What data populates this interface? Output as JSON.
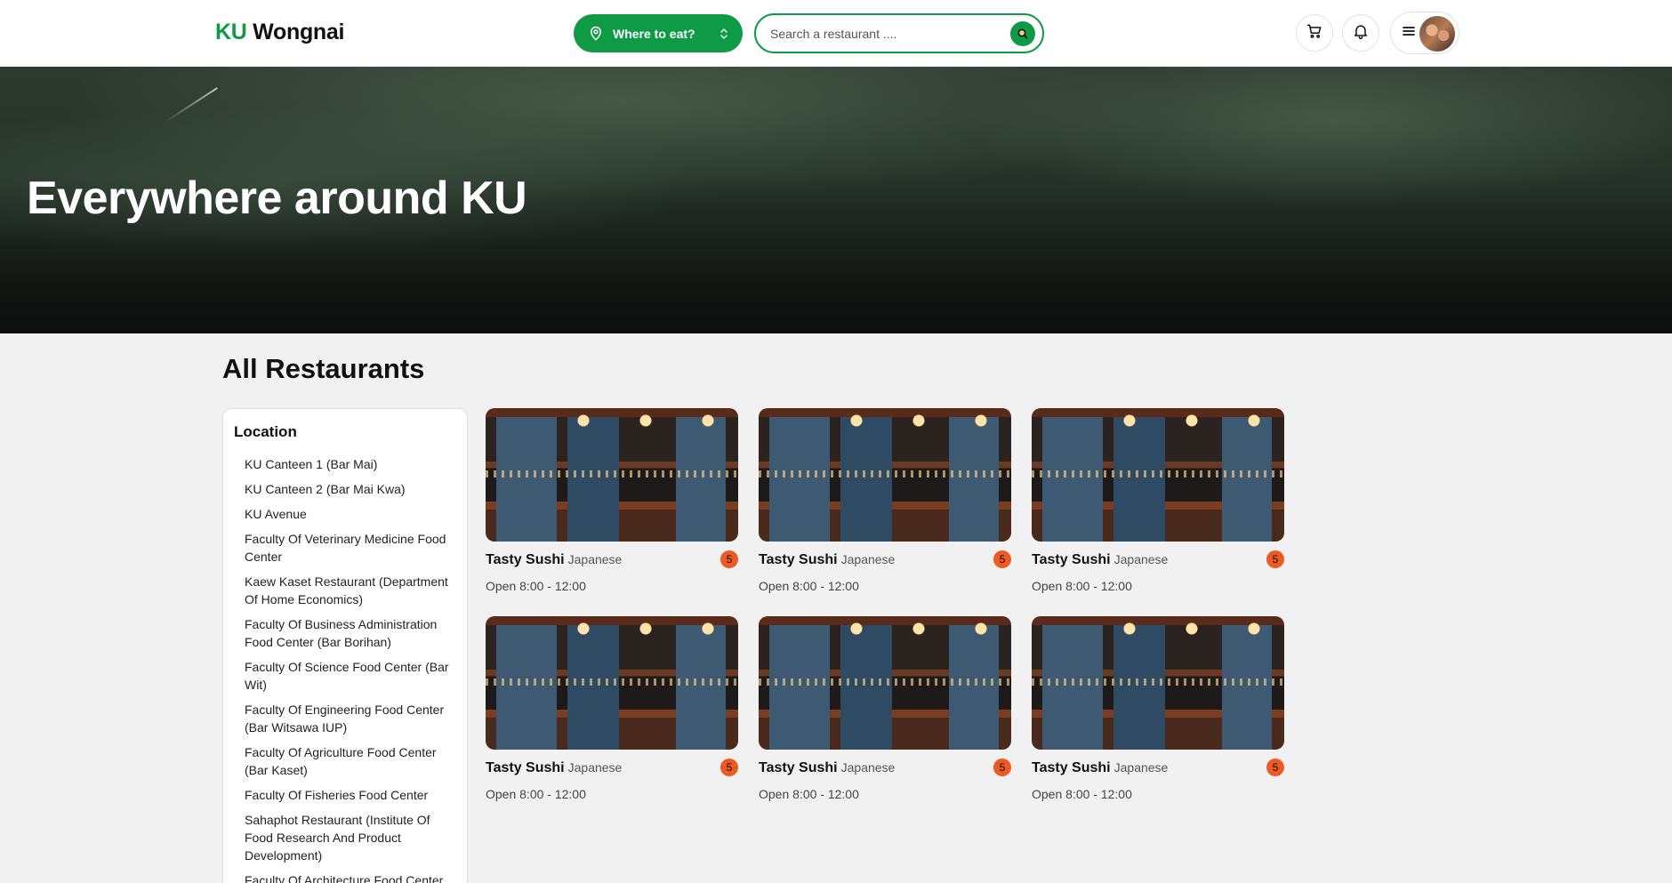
{
  "header": {
    "logo_ku": "KU",
    "logo_rest": "Wongnai",
    "where_label": "Where to eat?",
    "search_placeholder": "Search a restaurant ....",
    "icons": [
      "map-pin-icon",
      "chevron-updown-icon",
      "search-icon",
      "cart-icon",
      "bell-icon",
      "menu-icon"
    ]
  },
  "hero": {
    "title": "Everywhere around KU"
  },
  "main": {
    "title": "All Restaurants"
  },
  "sidebar": {
    "heading": "Location",
    "items": [
      "KU Canteen 1 (Bar Mai)",
      "KU Canteen 2 (Bar Mai Kwa)",
      "KU Avenue",
      "Faculty Of Veterinary Medicine Food Center",
      "Kaew Kaset Restaurant (Department Of Home Economics)",
      "Faculty Of Business Administration Food Center (Bar Borihan)",
      "Faculty Of Science Food Center (Bar Wit)",
      "Faculty Of Engineering Food Center (Bar Witsawa IUP)",
      "Faculty Of Agriculture Food Center (Bar Kaset)",
      "Faculty Of Fisheries Food Center",
      "Sahaphot Restaurant (Institute Of Food Research And Product Development)",
      "Faculty Of Architecture Food Center"
    ]
  },
  "restaurants": [
    {
      "name": "Tasty Sushi",
      "cuisine": "Japanese",
      "rating": "5",
      "hours": "Open 8:00 - 12:00"
    },
    {
      "name": "Tasty Sushi",
      "cuisine": "Japanese",
      "rating": "5",
      "hours": "Open 8:00 - 12:00"
    },
    {
      "name": "Tasty Sushi",
      "cuisine": "Japanese",
      "rating": "5",
      "hours": "Open 8:00 - 12:00"
    },
    {
      "name": "Tasty Sushi",
      "cuisine": "Japanese",
      "rating": "5",
      "hours": "Open 8:00 - 12:00"
    },
    {
      "name": "Tasty Sushi",
      "cuisine": "Japanese",
      "rating": "5",
      "hours": "Open 8:00 - 12:00"
    },
    {
      "name": "Tasty Sushi",
      "cuisine": "Japanese",
      "rating": "5",
      "hours": "Open 8:00 - 12:00"
    }
  ],
  "colors": {
    "brand_green": "#0f9a46",
    "rating_badge": "#ee5a24",
    "page_bg": "#f1f1f1"
  }
}
